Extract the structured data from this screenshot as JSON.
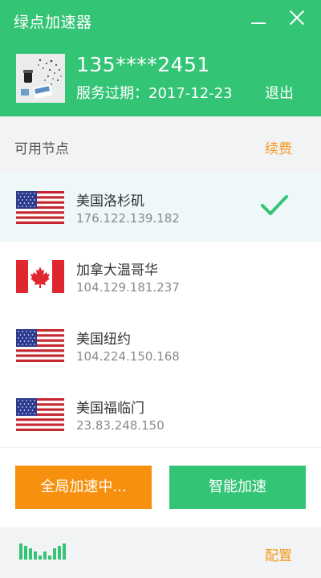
{
  "app": {
    "title": "绿点加速器",
    "brand_color": "#33c475",
    "accent_color": "#f7900f"
  },
  "window_controls": {
    "minimize_icon": "minimize-icon",
    "close_icon": "close-icon"
  },
  "user": {
    "avatar": "avatar-photo",
    "phone": "135****2451",
    "expiry": "服务过期：2017-12-23",
    "logout_label": "退出"
  },
  "nodes_section": {
    "title": "可用节点",
    "renew_label": "续费"
  },
  "nodes": [
    {
      "name": "美国洛杉矶",
      "ip": "176.122.139.182",
      "flag": "us-flag-icon",
      "selected": true
    },
    {
      "name": "加拿大温哥华",
      "ip": "104.129.181.237",
      "flag": "canada-flag-icon",
      "selected": false
    },
    {
      "name": "美国纽约",
      "ip": "104.224.150.168",
      "flag": "us-flag-icon",
      "selected": false
    },
    {
      "name": "美国福临门",
      "ip": "23.83.248.150",
      "flag": "us-flag-icon",
      "selected": false
    }
  ],
  "actions": {
    "global_label": "全局加速中...",
    "smart_label": "智能加速"
  },
  "footer": {
    "speed_icon": "speed-bars-icon",
    "settings_label": "配置"
  }
}
